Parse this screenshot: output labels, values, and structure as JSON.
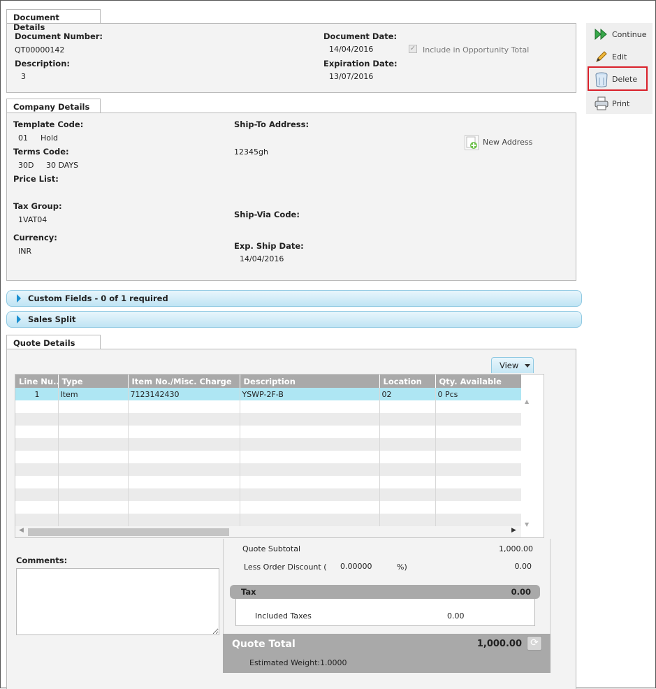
{
  "document_details": {
    "tab_title": "Document Details",
    "document_number_label": "Document Number:",
    "document_number": "QT00000142",
    "description_label": "Description:",
    "description": "3",
    "document_date_label": "Document Date:",
    "document_date": "14/04/2016",
    "include_label": "Include in Opportunity Total",
    "expiration_date_label": "Expiration Date:",
    "expiration_date": "13/07/2016"
  },
  "actions": {
    "continue": "Continue",
    "edit": "Edit",
    "delete": "Delete",
    "print": "Print"
  },
  "company_details": {
    "tab_title": "Company Details",
    "template_code_label": "Template Code:",
    "template_code": "01",
    "template_name": "Hold",
    "terms_code_label": "Terms Code:",
    "terms_code": "30D",
    "terms_name": "30 DAYS",
    "price_list_label": "Price List:",
    "tax_group_label": "Tax Group:",
    "tax_group": "1VAT04",
    "currency_label": "Currency:",
    "currency": "INR",
    "ship_to_label": "Ship-To Address:",
    "ship_to": "12345gh",
    "new_address": "New Address",
    "ship_via_label": "Ship-Via Code:",
    "exp_ship_date_label": "Exp. Ship Date:",
    "exp_ship_date": "14/04/2016"
  },
  "accordions": {
    "custom_fields": "Custom Fields - 0 of 1 required",
    "sales_split": "Sales Split"
  },
  "quote_details": {
    "tab_title": "Quote Details",
    "view_button": "View",
    "columns": [
      "Line Nu..",
      "Type",
      "Item No./Misc. Charge",
      "Description",
      "Location",
      "Qty. Available"
    ],
    "rows": [
      [
        "1",
        "Item",
        "7123142430",
        "YSWP-2F-B",
        "02",
        "0 Pcs"
      ]
    ],
    "comments_label": "Comments:"
  },
  "totals": {
    "subtotal_label": "Quote Subtotal",
    "subtotal": "1,000.00",
    "discount_label": "Less Order Discount (",
    "discount_pct": "0.00000",
    "discount_pct_close": "%)",
    "discount_amount": "0.00",
    "tax_label": "Tax",
    "tax": "0.00",
    "included_taxes_label": "Included Taxes",
    "included_taxes": "0.00",
    "quote_total_label": "Quote Total",
    "quote_total": "1,000.00",
    "weight_label": "Estimated Weight:",
    "weight": "1.0000"
  },
  "colors": {
    "accent_blue": "#1a8fd0",
    "highlight_row": "#aee6f3",
    "delete_outline": "#d9202a"
  }
}
